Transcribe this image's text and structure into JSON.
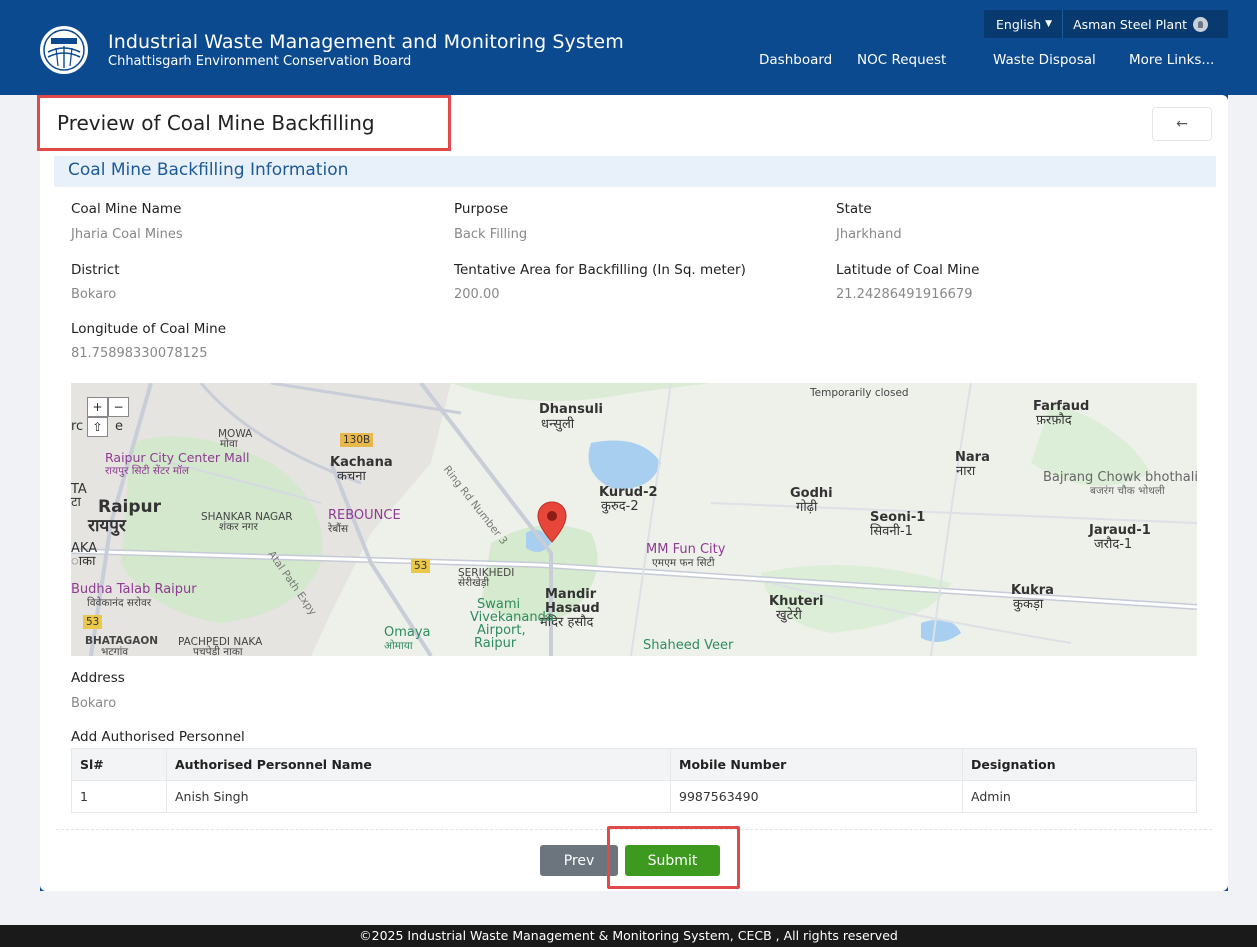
{
  "header": {
    "title": "Industrial Waste Management and Monitoring System",
    "subtitle": "Chhattisgarh Environment Conservation Board",
    "language": "English",
    "user": "Asman Steel Plant",
    "nav": [
      "Dashboard",
      "NOC Request",
      "Waste Disposal",
      "More Links..."
    ]
  },
  "page": {
    "title": "Preview of Coal Mine Backfilling",
    "back_icon": "←",
    "section_title": "Coal Mine Backfilling Information"
  },
  "fields": {
    "coal_mine_name": {
      "label": "Coal Mine Name",
      "value": "Jharia Coal Mines"
    },
    "purpose": {
      "label": "Purpose",
      "value": "Back Filling"
    },
    "state": {
      "label": "State",
      "value": "Jharkhand"
    },
    "district": {
      "label": "District",
      "value": "Bokaro"
    },
    "area": {
      "label": "Tentative Area for Backfilling (In Sq. meter)",
      "value": "200.00"
    },
    "latitude": {
      "label": "Latitude of Coal Mine",
      "value": "21.24286491916679"
    },
    "longitude": {
      "label": "Longitude of Coal Mine",
      "value": "81.75898330078125"
    },
    "address": {
      "label": "Address",
      "value": "Bokaro"
    }
  },
  "map": {
    "zoom_in": "+",
    "zoom_out": "−",
    "reset": "⇧",
    "labels": {
      "dhansuli": "Dhansuli",
      "dhansuli_hi": "धन्सुली",
      "farfaud": "Farfaud",
      "farfaud_hi": "फ़रफ़ौद",
      "temporarily": "Temporarily closed",
      "mowa": "MOWA",
      "mowa_hi": "मोवा",
      "raipur_city": "Raipur City Center Mall",
      "raipur_city_hi": "रायपुर सिटी सेंटर मॉल",
      "kachana": "Kachana",
      "kachana_hi": "कचना",
      "nara": "Nara",
      "nara_hi": "नारा",
      "bajrang": "Bajrang Chowk bhothali",
      "bajrang_hi": "बजरंग चौक भोथली",
      "raipur": "Raipur",
      "raipur_hi": "रायपुर",
      "shankar": "SHANKAR NAGAR",
      "shankar_hi": "शंकर नगर",
      "rebounce": "REBOUNCE",
      "rebounce_hi": "रेबौंस",
      "kurud": "Kurud-2",
      "kurud_hi": "कुरुद-2",
      "godhi": "Godhi",
      "godhi_hi": "गोढ़ी",
      "seoni": "Seoni-1",
      "seoni_hi": "सिवनी-1",
      "jaraud": "Jaraud-1",
      "jaraud_hi": "जरौद-1",
      "mm_fun": "MM Fun City",
      "mm_fun_hi": "एमएम फन सिटी",
      "serikhedi": "SERIKHEDI",
      "serikhedi_hi": "सेरीखेड़ी",
      "budha": "Budha Talab Raipur",
      "budha_hi": "विवेकानंद सरोवर",
      "mandir": "Mandir",
      "hasaud": "Hasaud",
      "mandir_hi": "मंदिर हसौद",
      "swami": "Swami",
      "vivekananda": "Vivekananda",
      "airport": "Airport,",
      "raipur2": "Raipur",
      "khuteri": "Khuteri",
      "khuteri_hi": "खुटेरी",
      "kukra": "Kukra",
      "kukra_hi": "कुकड़ा",
      "bhatagaon": "BHATAGAON",
      "bhatagaon_hi": "भटगांव",
      "pachpedi": "PACHPEDI NAKA",
      "pachpedi_hi": "पचपेड़ी नाका",
      "omaya": "Omaya",
      "omaya_hi": "ओमाया",
      "shaheed": "Shaheed Veer",
      "ta": "TA",
      "ta_hi": "टा",
      "aka": "AKA",
      "aka_hi": "ाका",
      "rc": "rc",
      "e": "e",
      "ring_road": "Ring Rd Number 3",
      "atal": "Atal Path Expy",
      "r130b": "130B",
      "r53": "53",
      "r53b": "53",
      "r130": "130B"
    }
  },
  "personnel": {
    "section_label": "Add Authorised Personnel",
    "columns": [
      "Sl#",
      "Authorised Personnel Name",
      "Mobile Number",
      "Designation"
    ],
    "rows": [
      [
        "1",
        "Anish Singh",
        "9987563490",
        "Admin"
      ]
    ]
  },
  "actions": {
    "prev": "Prev",
    "submit": "Submit"
  },
  "footer": "©2025 Industrial Waste Management & Monitoring System, CECB , All rights reserved"
}
